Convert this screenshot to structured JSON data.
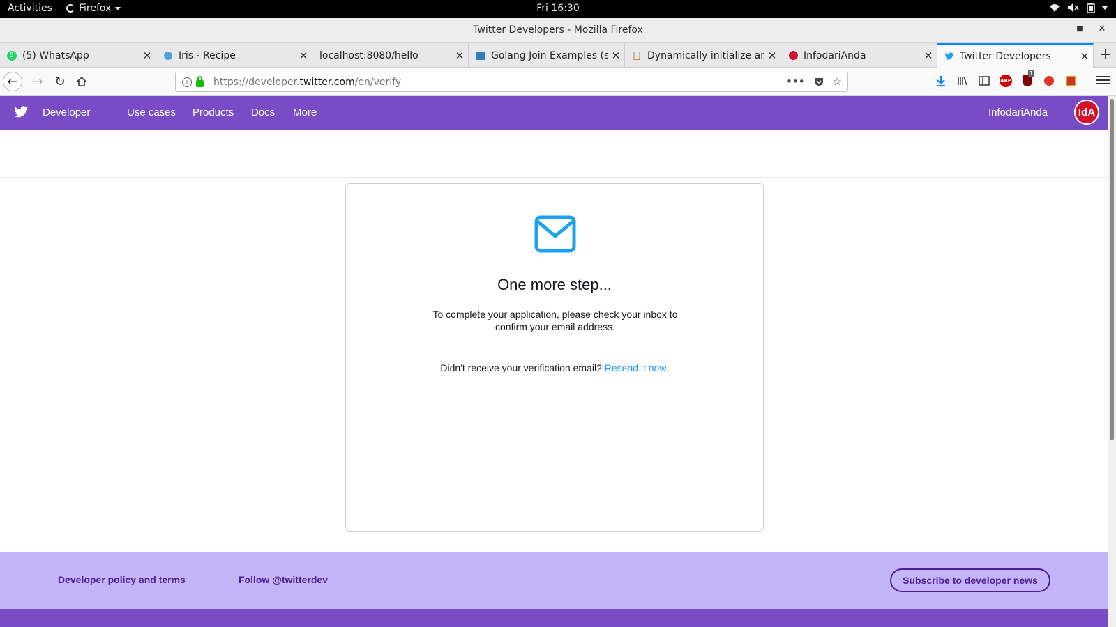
{
  "system_bar": {
    "activities": "Activities",
    "app": "Firefox",
    "clock": "Fri 16:30"
  },
  "window": {
    "title": "Twitter Developers - Mozilla Firefox"
  },
  "tabs": [
    {
      "label": "(5) WhatsApp"
    },
    {
      "label": "Iris - Recipe"
    },
    {
      "label": "localhost:8080/hello"
    },
    {
      "label": "Golang Join Examples (str"
    },
    {
      "label": "Dynamically initialize array"
    },
    {
      "label": "InfodariAnda"
    },
    {
      "label": "Twitter Developers"
    }
  ],
  "tab_badges": {
    "whatsapp": "5",
    "ublock": "1"
  },
  "address": {
    "prefix": "https://developer.",
    "domain": "twitter.com",
    "path": "/en/verify"
  },
  "toolbar_icons": {
    "adblock": "ABP"
  },
  "twitter_nav": {
    "brand": "Developer",
    "links": [
      "Use cases",
      "Products",
      "Docs",
      "More"
    ],
    "username": "InfodariAnda",
    "avatar_text": "IdA"
  },
  "verify_card": {
    "heading": "One more step...",
    "message": "To complete your application, please check your inbox to confirm your email address.",
    "resend_prompt": "Didn't receive your verification email?",
    "resend_link": "Resend it now."
  },
  "footer": {
    "policy_link": "Developer policy and terms",
    "follow_link": "Follow @twitterdev",
    "subscribe_button": "Subscribe to developer news"
  },
  "colors": {
    "twitter_nav": "#794bc4",
    "footer": "#c5b4f7",
    "link_blue": "#1da1f2",
    "avatar_red": "#d0112b"
  }
}
